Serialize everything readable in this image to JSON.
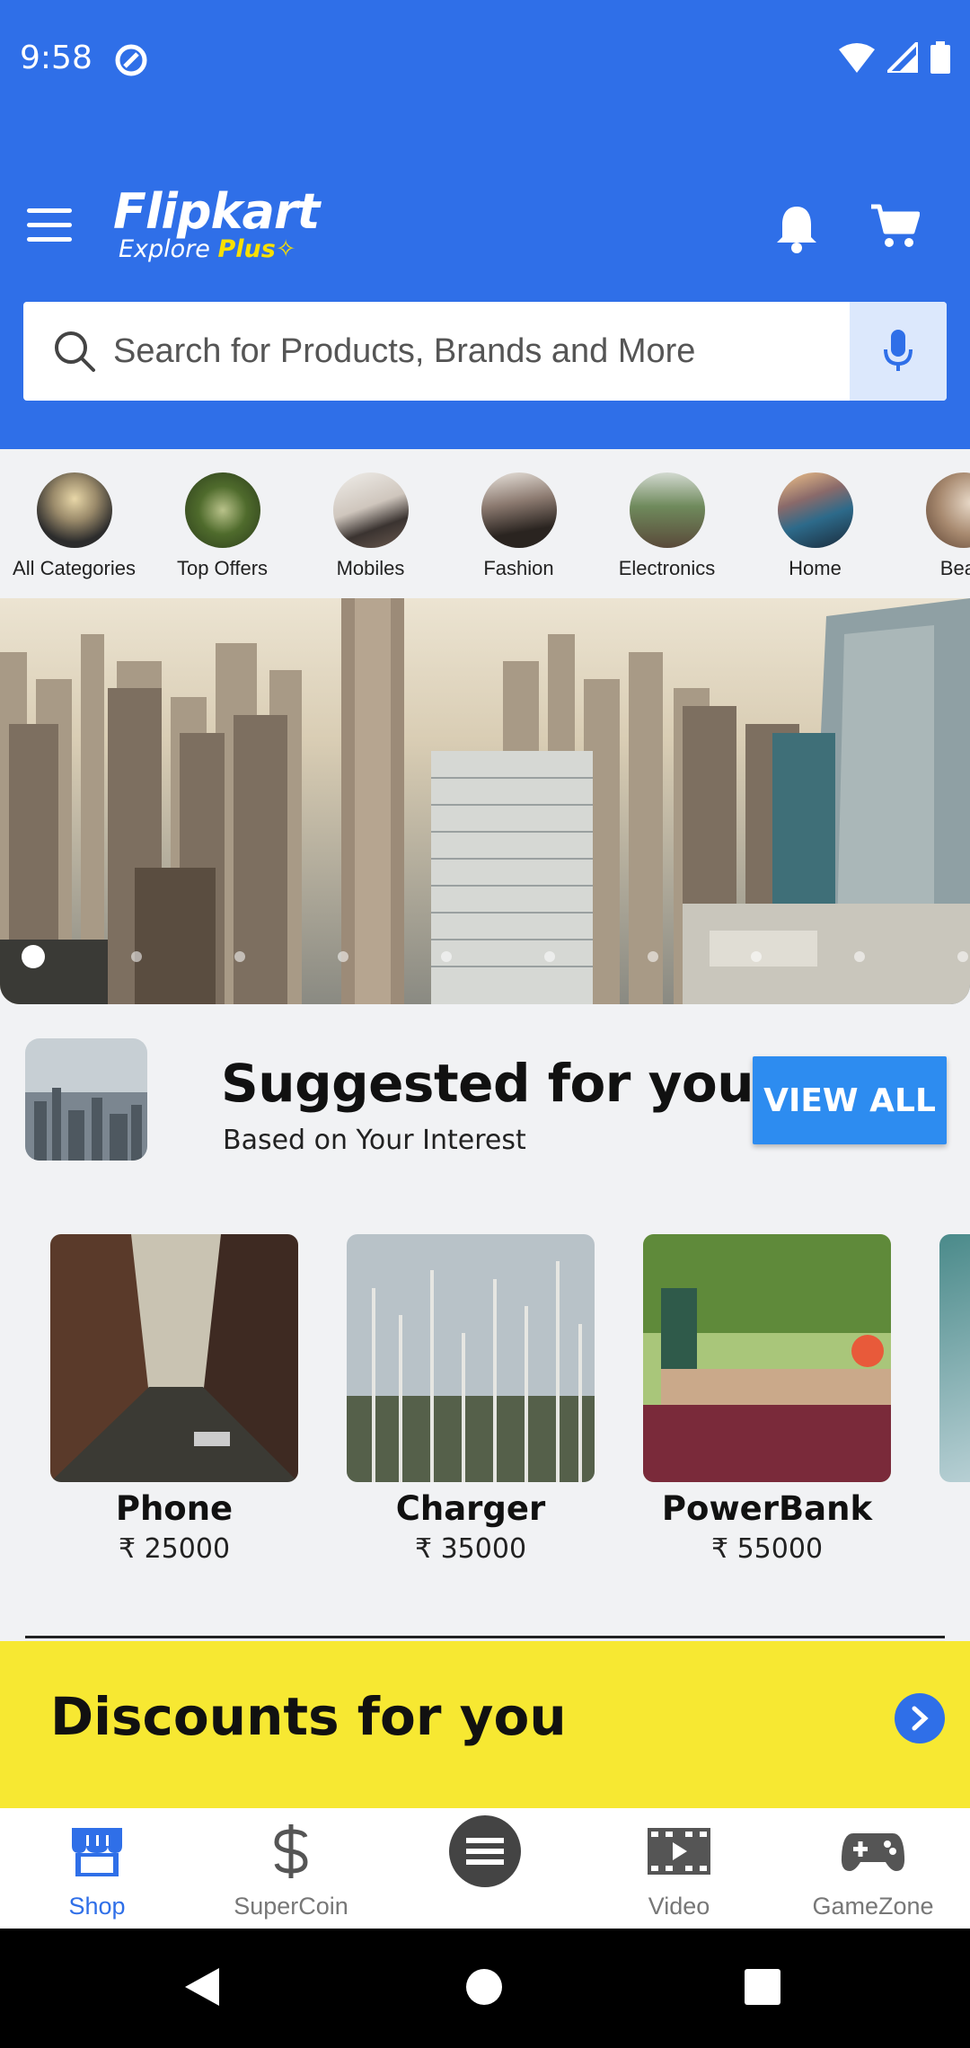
{
  "status_bar": {
    "time": "9:58"
  },
  "header": {
    "logo_main": "Flipkart",
    "logo_sub_prefix": "Explore",
    "logo_sub_accent": "Plus",
    "brand_color": "#2f6fe8",
    "accent_color": "#f9e000"
  },
  "search": {
    "placeholder": "Search for Products, Brands and More"
  },
  "categories": [
    {
      "label": "All Categories"
    },
    {
      "label": "Top Offers"
    },
    {
      "label": "Mobiles"
    },
    {
      "label": "Fashion"
    },
    {
      "label": "Electronics"
    },
    {
      "label": "Home"
    },
    {
      "label": "Beau"
    }
  ],
  "banner": {
    "slide_count": 10,
    "active_slide": 1
  },
  "suggested": {
    "title": "Suggested for you",
    "subtitle": "Based on Your Interest",
    "view_all_label": "VIEW ALL",
    "products": [
      {
        "name": "Phone",
        "price": "₹ 25000"
      },
      {
        "name": "Charger",
        "price": "₹ 35000"
      },
      {
        "name": "PowerBank",
        "price": "₹ 55000"
      }
    ]
  },
  "discounts": {
    "title": "Discounts for you",
    "bg_color": "#f7e832"
  },
  "bottom_nav": {
    "items": [
      {
        "label": "Shop",
        "icon": "shop-icon",
        "active": true
      },
      {
        "label": "SuperCoin",
        "icon": "dollar-icon",
        "active": false
      },
      {
        "label": "",
        "icon": "menu-circle-icon",
        "active": false
      },
      {
        "label": "Video",
        "icon": "video-icon",
        "active": false
      },
      {
        "label": "GameZone",
        "icon": "gamepad-icon",
        "active": false
      }
    ]
  }
}
